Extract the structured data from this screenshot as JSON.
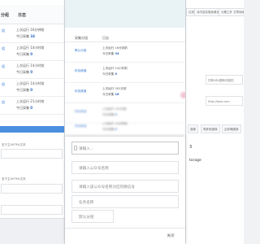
{
  "left": {
    "header": {
      "col1": "分组",
      "col2": "日志"
    },
    "rows": [
      {
        "tag": "组",
        "line1": "上次运行 16分钟前",
        "line2": "今日采集",
        "count": "34"
      },
      {
        "tag": "组",
        "line1": "上次运行 14小时前",
        "line2": "今日采集",
        "count": "0"
      },
      {
        "tag": "组",
        "line1": "上次运行 14小时前",
        "line2": "今日采集",
        "count": "0"
      },
      {
        "tag": "组",
        "line1": "上次运行 14小时前",
        "line2": "今日采集",
        "count": "0"
      },
      {
        "tag": "组",
        "line1": "上次运行 21小时前",
        "line2": "今日采集",
        "count": "0"
      }
    ],
    "labels": [
      "至于主XHTML文本",
      "至于主XHTML文本"
    ]
  },
  "right": {
    "tabs": [
      "过滤",
      "对内容实施伪原创",
      "元素之外 文章阅读数"
    ],
    "select_value": "在转URL跳转可能的",
    "url_value": "http://task.com",
    "tabs2": [
      "选择",
      "同步到选择",
      "云存储选择"
    ],
    "storage_label": "torage",
    "field_label": "3"
  },
  "list": {
    "header": {
      "col1": "采集分组",
      "col2": "日志"
    },
    "rows": [
      {
        "tag": "默认分组",
        "line1": "上次运行 16分钟前",
        "line2": "今日采集",
        "count": "34"
      },
      {
        "tag": "科技频道",
        "line1": "上次运行 14小时前",
        "line2": "今日采集",
        "count": "0"
      },
      {
        "tag": "科技频道",
        "line1": "上次运行 202天前",
        "line2": "今日采集",
        "count": "16"
      },
      {
        "tag": "财经频道",
        "line1": "上次运行 202天前",
        "line2": "今日采集",
        "count": "0"
      },
      {
        "tag": "财经频道",
        "line1": "上次运行 20分钟前",
        "line2": "今日采集",
        "count": "0"
      }
    ]
  },
  "form": {
    "field1_placeholder": "请输入...",
    "field2_placeholder": "请输入公众号名称",
    "field3_placeholder": "请输入该公众号名称对应的微信号",
    "field4_placeholder": "任务名称",
    "group_select": "默认分组",
    "close_label": "关闭"
  }
}
